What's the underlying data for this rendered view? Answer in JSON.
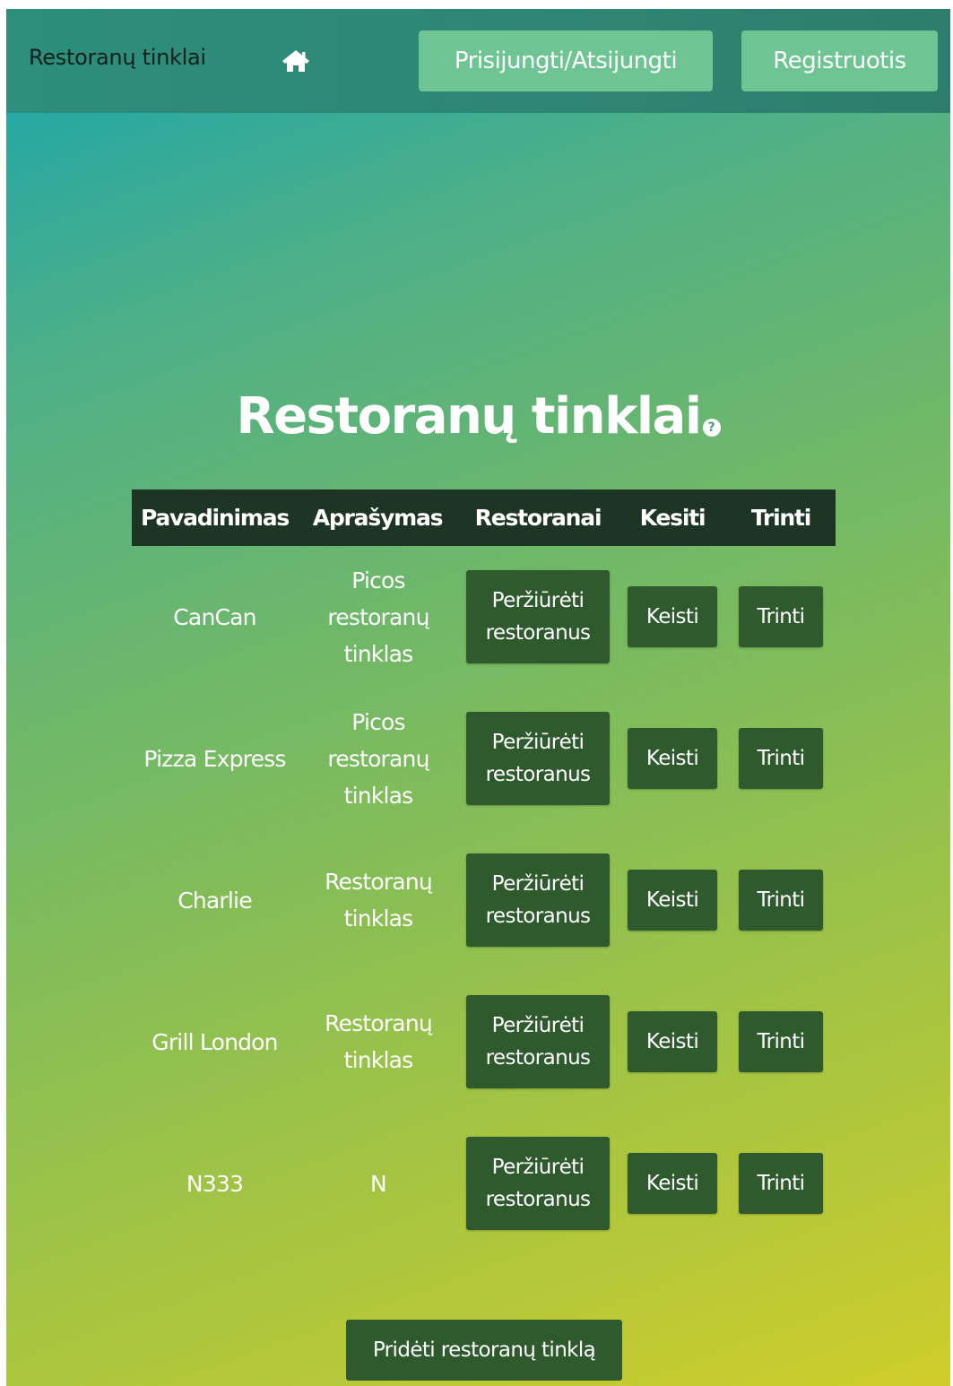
{
  "navbar": {
    "brand": "Restoranų tinklai",
    "home_icon": "home-icon",
    "login_label": "Prisijungti/Atsijungti",
    "register_label": "Registruotis"
  },
  "main": {
    "title": "Restoranų tinklai",
    "help_icon_glyph": "?",
    "table": {
      "headers": [
        "Pavadinimas",
        "Aprašymas",
        "Restoranai",
        "Kesiti",
        "Trinti"
      ],
      "rows": [
        {
          "name": "CanCan",
          "description": "Picos restoranų tinklas",
          "view_label": "Peržiūrėti restoranus",
          "edit_label": "Keisti",
          "delete_label": "Trinti"
        },
        {
          "name": "Pizza Express",
          "description": "Picos restoranų tinklas",
          "view_label": "Peržiūrėti restoranus",
          "edit_label": "Keisti",
          "delete_label": "Trinti"
        },
        {
          "name": "Charlie",
          "description": "Restoranų tinklas",
          "view_label": "Peržiūrėti restoranus",
          "edit_label": "Keisti",
          "delete_label": "Trinti"
        },
        {
          "name": "Grill London",
          "description": "Restoranų tinklas",
          "view_label": "Peržiūrėti restoranus",
          "edit_label": "Keisti",
          "delete_label": "Trinti"
        },
        {
          "name": "N333",
          "description": "N",
          "view_label": "Peržiūrėti restoranus",
          "edit_label": "Keisti",
          "delete_label": "Trinti"
        }
      ]
    },
    "add_label": "Pridėti restoranų tinklą"
  },
  "colors": {
    "navbar": "#2f8573",
    "nav_button": "#6ec492",
    "table_header": "#1e3526",
    "action_button": "#2f5a2e"
  }
}
